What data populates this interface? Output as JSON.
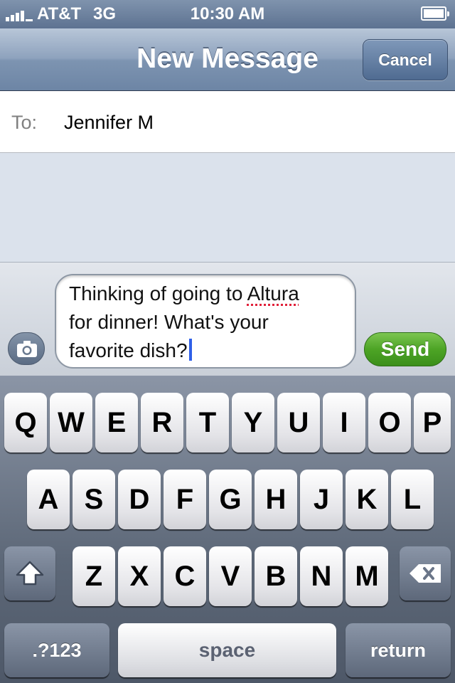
{
  "status_bar": {
    "carrier": "AT&T",
    "network": "3G",
    "time": "10:30 AM"
  },
  "nav": {
    "title": "New Message",
    "cancel_label": "Cancel"
  },
  "recipient": {
    "label": "To:",
    "name": "Jennifer M"
  },
  "compose": {
    "line1_before": "Thinking of going to ",
    "misspelled_word": "Altura",
    "line2": "for dinner! What's your",
    "line3": "favorite dish?",
    "send_label": "Send"
  },
  "keyboard": {
    "row1": [
      "Q",
      "W",
      "E",
      "R",
      "T",
      "Y",
      "U",
      "I",
      "O",
      "P"
    ],
    "row2": [
      "A",
      "S",
      "D",
      "F",
      "G",
      "H",
      "J",
      "K",
      "L"
    ],
    "row3": [
      "Z",
      "X",
      "C",
      "V",
      "B",
      "N",
      "M"
    ],
    "numbers_label": ".?123",
    "space_label": "space",
    "return_label": "return"
  }
}
